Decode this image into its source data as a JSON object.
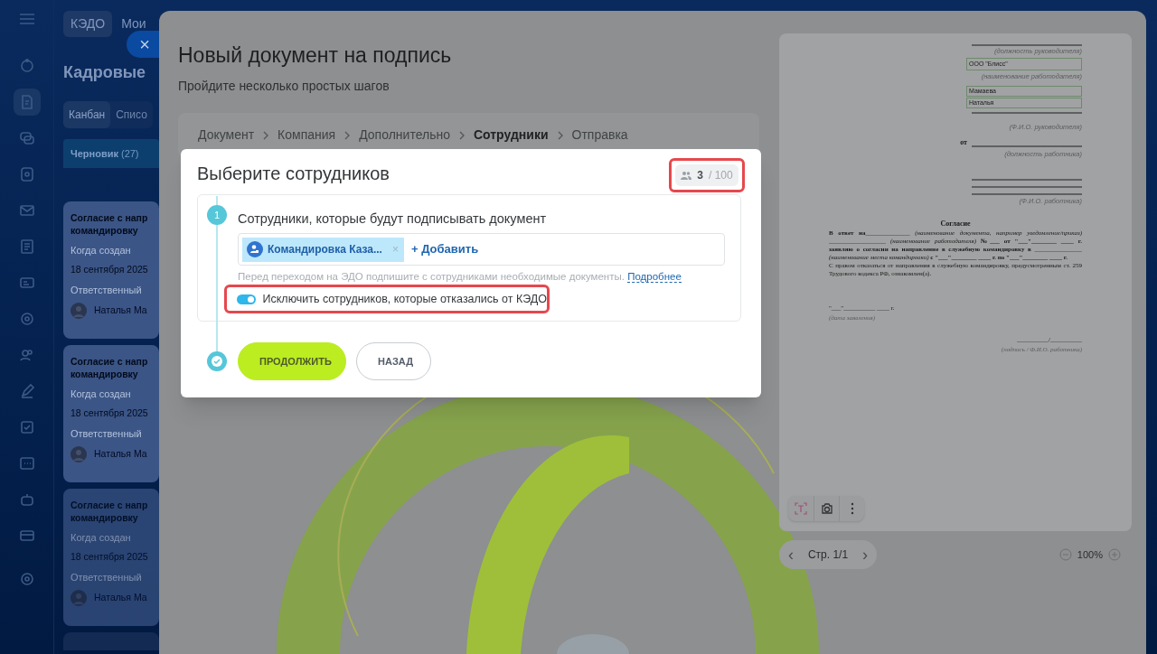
{
  "app": {
    "chip": "КЭДО",
    "menu_link": "Мои",
    "page_title": "Кадровые",
    "view_tabs": [
      {
        "label": "Канбан",
        "selected": true
      },
      {
        "label": "Списо",
        "selected": false
      }
    ],
    "column": {
      "title": "Черновик",
      "count": "(27)"
    },
    "cards": [
      {
        "title": [
          "Согласие с напр",
          "командировку"
        ],
        "created_label": "Когда создан",
        "created": "18 сентября 2025",
        "owner_label": "Ответственный",
        "owner": "Наталья Ма"
      },
      {
        "title": [
          "Согласие с напр",
          "командировку"
        ],
        "created_label": "Когда создан",
        "created": "18 сентября 2025",
        "owner_label": "Ответственный",
        "owner": "Наталья Ма"
      },
      {
        "title": [
          "Согласие с напр",
          "командировку"
        ],
        "created_label": "Когда создан",
        "created": "18 сентября 2025",
        "owner_label": "Ответственный",
        "owner": "Наталья Ма"
      }
    ]
  },
  "close_button": "×",
  "wizard": {
    "title": "Новый документ на подпись",
    "subtitle": "Пройдите несколько простых шагов",
    "steps": [
      {
        "label": "Документ",
        "selected": false
      },
      {
        "label": "Компания",
        "selected": false
      },
      {
        "label": "Дополнительно",
        "selected": false
      },
      {
        "label": "Сотрудники",
        "selected": true
      },
      {
        "label": "Отправка",
        "selected": false
      }
    ]
  },
  "dialog": {
    "title": "Выберите сотрудников",
    "counter": {
      "value": "3",
      "limit": "/ 100"
    },
    "step_number": "1",
    "section_title": "Сотрудники, которые будут подписывать документ",
    "chips": [
      {
        "label": "Командировка Каза...",
        "remove": "×"
      }
    ],
    "add_link": "+ Добавить",
    "hint": "Перед переходом на ЭДО подпишите с сотрудниками необходимые документы.",
    "hint_link": "Подробнее",
    "exclude_toggle": {
      "label": "Исключить сотрудников, которые отказались от КЭДО",
      "on": true
    },
    "buttons": [
      {
        "label": "ПРОДОЛЖИТЬ",
        "kind": "primary"
      },
      {
        "label": "НАЗАД",
        "kind": "secondary"
      }
    ]
  },
  "document": {
    "header": [
      {
        "kind": "line",
        "caption": "(должность руководителя)"
      },
      {
        "kind": "field",
        "value": "ООО \"Блисс\"",
        "caption": "(наименование работодателя)"
      },
      {
        "kind": "field2",
        "values": [
          "Мамаева",
          "Наталья"
        ],
        "caption": "(Ф.И.О. руководителя)"
      },
      {
        "kind": "from",
        "prefix": "от",
        "caption": "(должность работника)"
      },
      {
        "kind": "lines",
        "caption": "(Ф.И.О. работника)"
      }
    ],
    "heading": "Согласие",
    "paragraphs": [
      "**В ответ на**______________ *(наименование документа, например уведомление/приказ)* __________________ *(наименование работодателя)* **№___ от \"___\"________ ____ г. заявляю о согласии на направление в служебную командировку в** _______________ *(наименование места командировки)* **с \"___\"________ ____ г. по \"___\"________ ____ г.**",
      "С правом отказаться от направления в служебную командировку, предусмотренным ст. 259 Трудового кодекса РФ, ознакомлен(а)."
    ],
    "date_line": "\"___\"__________ ____ г.",
    "date_caption": "(дата заявления)",
    "sign_line": "__________/__________",
    "sign_caption": "(подпись / Ф.И.О. работника)",
    "pager": {
      "prev": "‹",
      "label": "Стр. 1/1",
      "next": "›"
    },
    "zoom": "100%"
  }
}
